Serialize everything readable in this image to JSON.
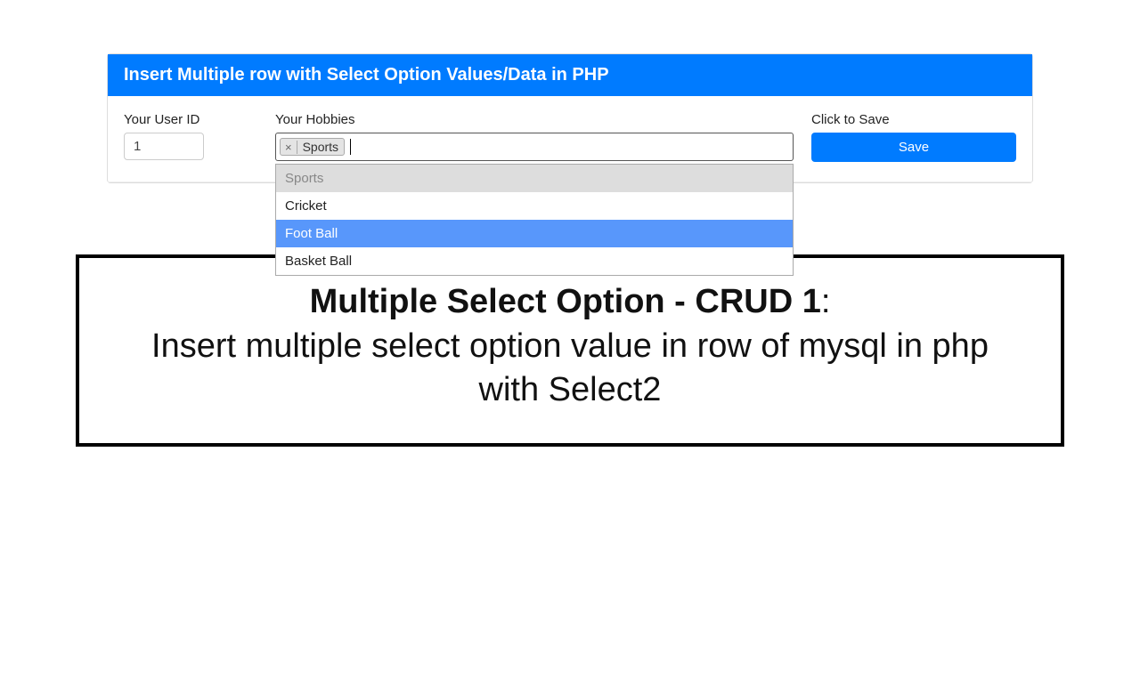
{
  "card": {
    "header": "Insert Multiple row with Select Option Values/Data in PHP",
    "userid_label": "Your User ID",
    "userid_value": "1",
    "hobbies_label": "Your Hobbies",
    "tag_remove": "×",
    "tag_text": "Sports",
    "options": {
      "o0": "Sports",
      "o1": "Cricket",
      "o2": "Foot Ball",
      "o3": "Basket Ball"
    },
    "save_label": "Click to Save",
    "save_button": "Save"
  },
  "caption": {
    "title": "Multiple Select Option - CRUD 1",
    "colon": ":",
    "subtitle": "Insert multiple select option value in row of mysql in php with Select2"
  },
  "colors": {
    "primary": "#007bff",
    "highlight": "#5897fb"
  }
}
